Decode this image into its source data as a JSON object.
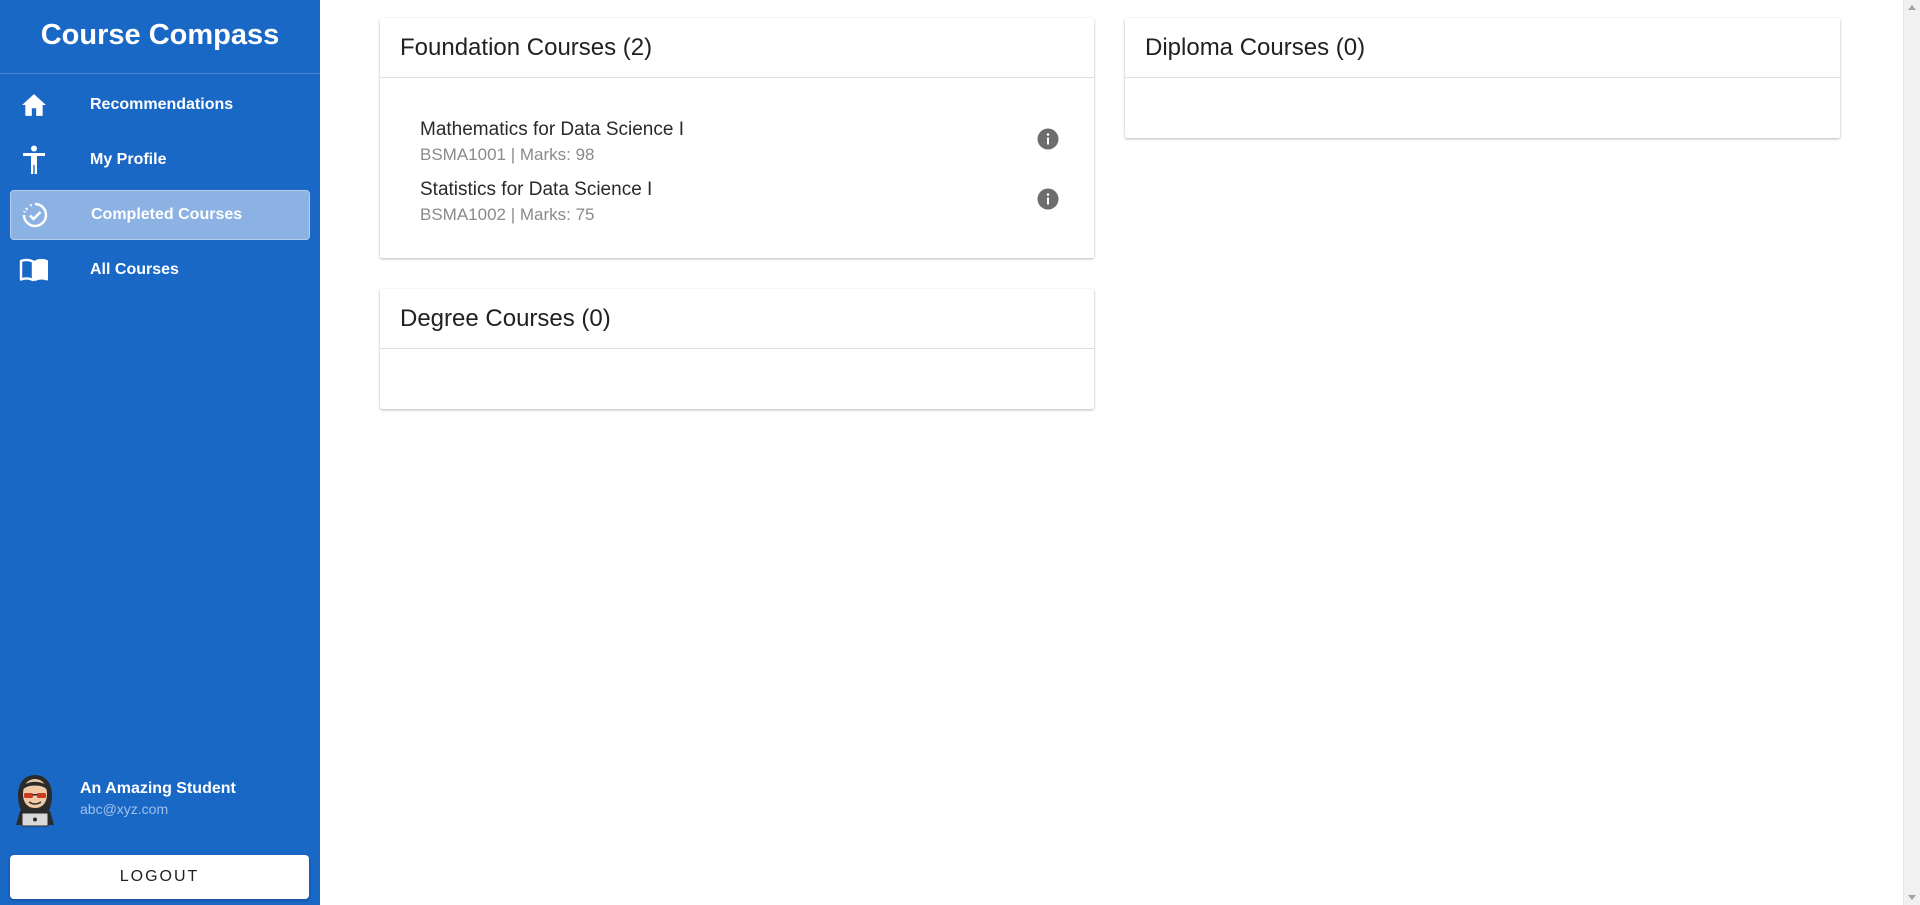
{
  "app": {
    "title": "Course Compass"
  },
  "sidebar": {
    "items": [
      {
        "label": "Recommendations",
        "icon": "home-icon",
        "active": false
      },
      {
        "label": "My Profile",
        "icon": "accessibility-icon",
        "active": false
      },
      {
        "label": "Completed Courses",
        "icon": "check-circle-dashed-icon",
        "active": true
      },
      {
        "label": "All Courses",
        "icon": "book-open-icon",
        "active": false
      }
    ]
  },
  "user": {
    "name": "An Amazing Student",
    "email": "abc@xyz.com",
    "avatar_icon": "hacker-avatar-icon"
  },
  "logout": {
    "label": "LOGOUT"
  },
  "sections": {
    "foundation": {
      "title": "Foundation Courses (2)",
      "courses": [
        {
          "title": "Mathematics for Data Science I",
          "meta": "BSMA1001 | Marks: 98"
        },
        {
          "title": "Statistics for Data Science I",
          "meta": "BSMA1002 | Marks: 75"
        }
      ]
    },
    "diploma": {
      "title": "Diploma Courses (0)",
      "courses": []
    },
    "degree": {
      "title": "Degree Courses (0)",
      "courses": []
    }
  },
  "colors": {
    "sidebar_bg": "#1a68c6",
    "active_item_bg": "#8cb1e3",
    "email_text": "#9ec1ec",
    "info_icon": "#6d6d6d"
  }
}
